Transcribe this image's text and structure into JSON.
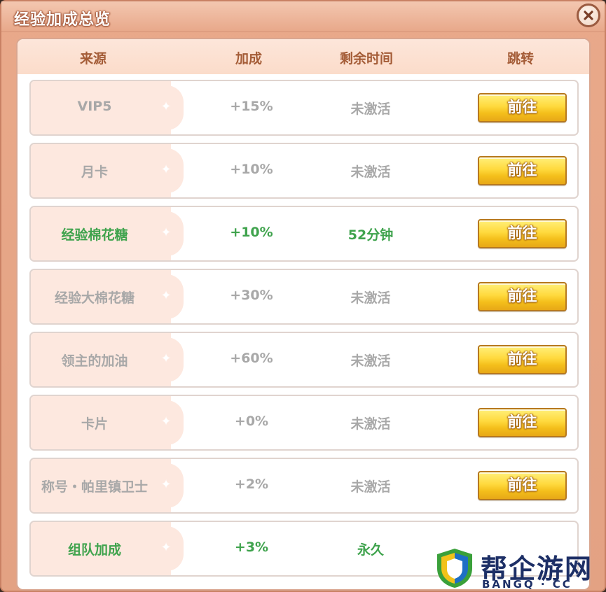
{
  "window": {
    "title": "经验加成总览"
  },
  "table": {
    "headers": {
      "source": "来源",
      "bonus": "加成",
      "remaining": "剩余时间",
      "jump": "跳转"
    },
    "rows": [
      {
        "source": "VIP5",
        "bonus": "+15%",
        "remaining": "未激活",
        "button": "前往",
        "active": false
      },
      {
        "source": "月卡",
        "bonus": "+10%",
        "remaining": "未激活",
        "button": "前往",
        "active": false
      },
      {
        "source": "经验棉花糖",
        "bonus": "+10%",
        "remaining": "52分钟",
        "button": "前往",
        "active": true
      },
      {
        "source": "经验大棉花糖",
        "bonus": "+30%",
        "remaining": "未激活",
        "button": "前往",
        "active": false
      },
      {
        "source": "领主的加油",
        "bonus": "+60%",
        "remaining": "未激活",
        "button": "前往",
        "active": false
      },
      {
        "source": "卡片",
        "bonus": "+0%",
        "remaining": "未激活",
        "button": "前往",
        "active": false
      },
      {
        "source": "称号・帕里镇卫士",
        "bonus": "+2%",
        "remaining": "未激活",
        "button": "前往",
        "active": false
      },
      {
        "source": "组队加成",
        "bonus": "+3%",
        "remaining": "永久",
        "button": "",
        "active": true
      }
    ]
  },
  "watermark": {
    "text": "帮企游网",
    "sub": "BANGQ · CC"
  },
  "colors": {
    "active_text": "#3fa34d",
    "inactive_text": "#a8a8a8",
    "header_text": "#a45c37",
    "button_gold": "#ffd93d"
  },
  "icons": {
    "close": "close-icon",
    "shield": "shield-logo-icon"
  }
}
